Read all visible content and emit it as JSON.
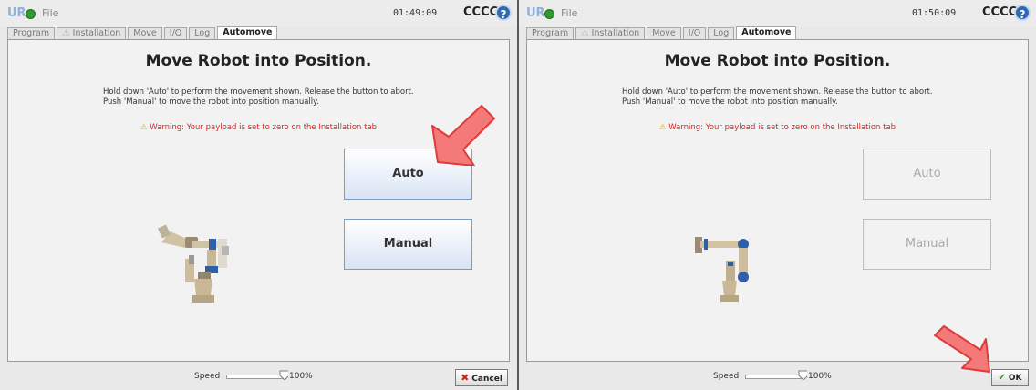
{
  "panels": [
    {
      "header": {
        "logo": "UR",
        "file_label": "File",
        "time": "01:49:09",
        "robot_name": "CCCC",
        "help_icon": "?"
      },
      "tabs": [
        {
          "label": "Program",
          "active": false
        },
        {
          "label": "Installation",
          "warning_icon": "⚠",
          "active": false
        },
        {
          "label": "Move",
          "active": false
        },
        {
          "label": "I/O",
          "active": false
        },
        {
          "label": "Log",
          "active": false
        },
        {
          "label": "Automove",
          "active": true
        }
      ],
      "title": "Move Robot into Position.",
      "instructions": [
        "Hold down 'Auto' to perform the movement shown. Release the button to abort.",
        "Push 'Manual' to move the robot into position manually."
      ],
      "warning_text": "Warning: Your payload is set to zero on the Installation tab",
      "warning_icon": "⚠",
      "auto_label": "Auto",
      "manual_label": "Manual",
      "buttons_enabled": true,
      "speed_label": "Speed",
      "speed_value": "100%",
      "speed_fraction": 1.0,
      "action_button": {
        "label": "Cancel",
        "icon": "x-icon",
        "glyph": "✖"
      },
      "highlight_arrow_target": "auto-button"
    },
    {
      "header": {
        "logo": "UR",
        "file_label": "File",
        "time": "01:50:09",
        "robot_name": "CCCC",
        "help_icon": "?"
      },
      "tabs": [
        {
          "label": "Program",
          "active": false
        },
        {
          "label": "Installation",
          "warning_icon": "⚠",
          "active": false
        },
        {
          "label": "Move",
          "active": false
        },
        {
          "label": "I/O",
          "active": false
        },
        {
          "label": "Log",
          "active": false
        },
        {
          "label": "Automove",
          "active": true
        }
      ],
      "title": "Move Robot into Position.",
      "instructions": [
        "Hold down 'Auto' to perform the movement shown. Release the button to abort.",
        "Push 'Manual' to move the robot into position manually."
      ],
      "warning_text": "Warning: Your payload is set to zero on the Installation tab",
      "warning_icon": "⚠",
      "auto_label": "Auto",
      "manual_label": "Manual",
      "buttons_enabled": false,
      "speed_label": "Speed",
      "speed_value": "100%",
      "speed_fraction": 1.0,
      "action_button": {
        "label": "OK",
        "icon": "checkmark-icon",
        "glyph": "✔"
      },
      "highlight_arrow_target": "ok-button"
    }
  ],
  "colors": {
    "warning_red": "#e02020",
    "arrow_fill": "#f47a7a",
    "arrow_stroke": "#e03a3a",
    "button_blue": "#7d9cc3"
  }
}
